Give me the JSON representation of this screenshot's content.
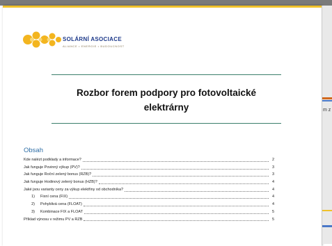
{
  "document": {
    "brand_name": "SOLÁRNÍ ASOCIACE",
    "brand_tagline": "ALIANCE • ENERGIE • BUDOUCNOST",
    "title_line1": "Rozbor forem podpory pro fotovoltaické",
    "title_line2": "elektrárny"
  },
  "side_panel": {
    "fragment_text": "m z"
  },
  "toc": {
    "heading": "Obsah",
    "entries": [
      {
        "label": "Kde nalézt podklady a informace?",
        "page": "2"
      },
      {
        "label": "Jak funguje Povinný výkup (PV)?",
        "page": "3"
      },
      {
        "label": "Jak funguje Roční zelený bonus (RZB)?",
        "page": "3"
      },
      {
        "label": "Jak funguje Hodinový zelený bonus (HZB)?",
        "page": "4"
      },
      {
        "label": "Jaké jsou varianty ceny za výkup elektřiny od obchodníka?",
        "page": "4"
      },
      {
        "num": "1)",
        "label": "Fixní cena (FIX)",
        "page": "4"
      },
      {
        "num": "2)",
        "label": "Pohyblivá cena (FLOAT)",
        "page": "4"
      },
      {
        "num": "3)",
        "label": "Kombinace FIX a FLOAT",
        "page": "5"
      },
      {
        "label": "Příklad výnosu v režimu PV a RZB",
        "page": "5"
      }
    ]
  },
  "colors": {
    "accent_yellow": "#f0c12a",
    "brand_blue": "#1e3a8a",
    "heading_blue": "#2e6ea6",
    "rule_green": "#3a7d6a"
  }
}
